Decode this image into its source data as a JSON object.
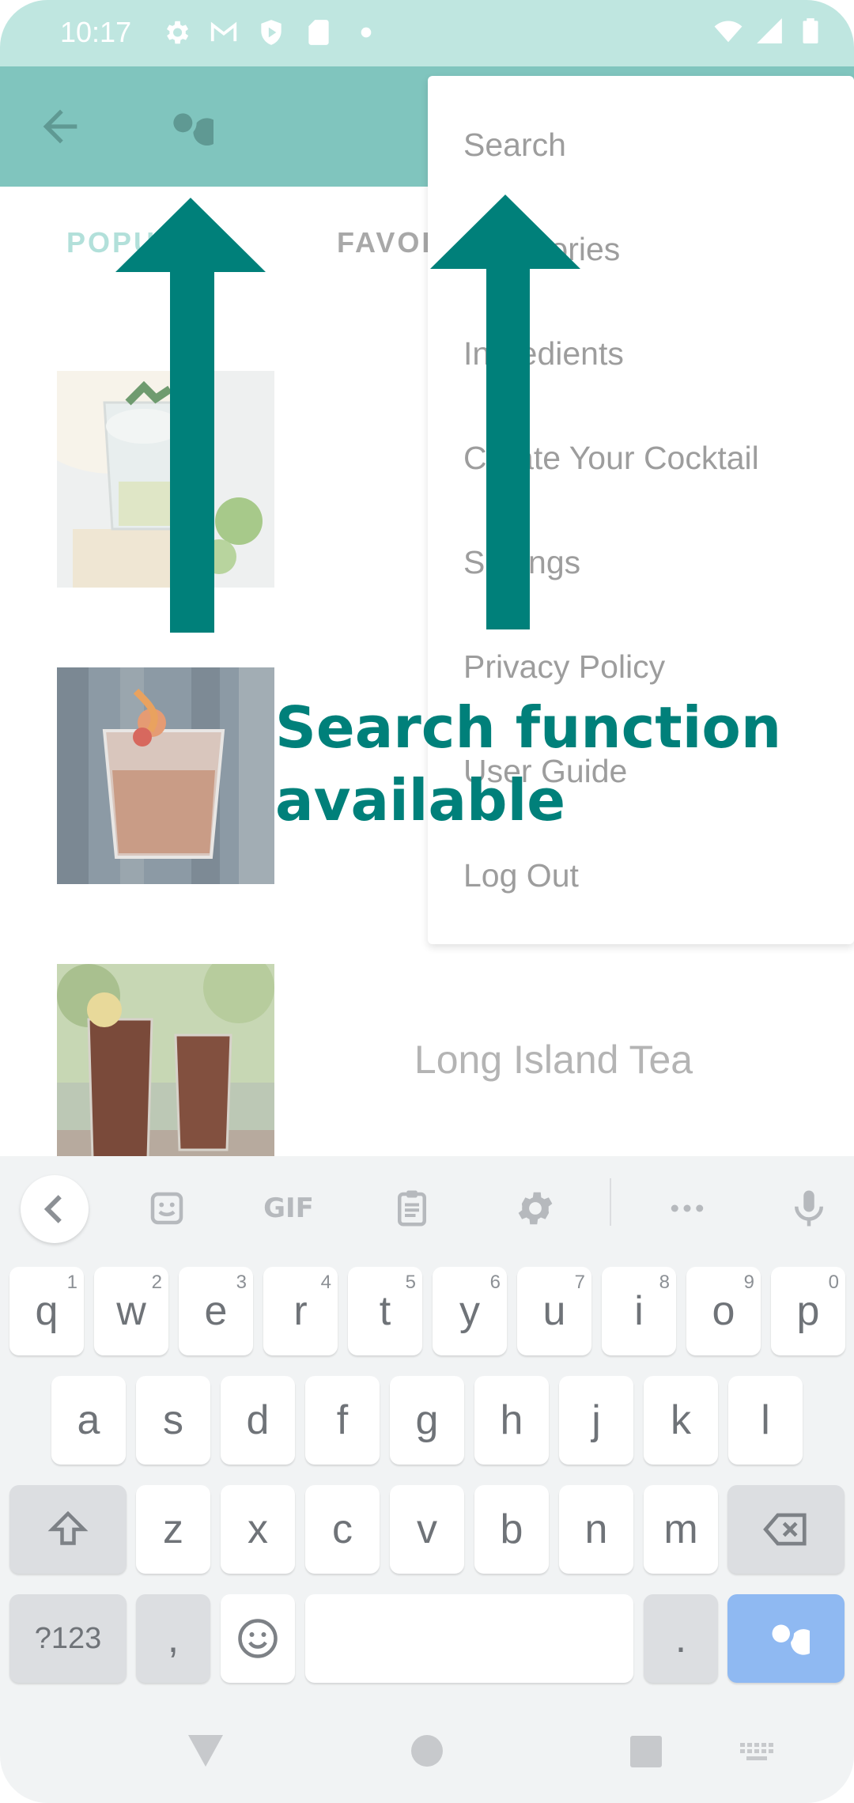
{
  "status_bar": {
    "time": "10:17",
    "left_icons": [
      "gear-icon",
      "gmail-icon",
      "shield-icon",
      "sdcard-icon",
      "dot-icon"
    ],
    "right_icons": [
      "wifi-icon",
      "signal-icon",
      "battery-icon"
    ]
  },
  "app_bar": {
    "back_icon": "arrow-back-icon",
    "search_icon": "search-icon",
    "color": "#80c5be"
  },
  "tabs": [
    {
      "label": "POPULAR",
      "selected": true
    },
    {
      "label": "FAVORITES",
      "selected": false
    }
  ],
  "list": {
    "items": [
      {
        "title": "",
        "image": "mojito-photo"
      },
      {
        "title": "",
        "image": "old-fashioned-photo"
      },
      {
        "title": "Long Island Tea",
        "image": "long-island-tea-photo"
      }
    ]
  },
  "menu": {
    "items": [
      "Search",
      "Categories",
      "Ingredients",
      "Create Your Cocktail",
      "Settings",
      "Privacy Policy",
      "User Guide",
      "Log Out"
    ]
  },
  "annotation": {
    "line1": "Search function",
    "line2": "available",
    "color": "#00807a"
  },
  "keyboard": {
    "toolbar": [
      "chevron-left-icon",
      "sticker-icon",
      "GIF",
      "clipboard-icon",
      "gear-icon",
      "more-icon",
      "mic-icon"
    ],
    "row1": [
      {
        "k": "q",
        "h": "1"
      },
      {
        "k": "w",
        "h": "2"
      },
      {
        "k": "e",
        "h": "3"
      },
      {
        "k": "r",
        "h": "4"
      },
      {
        "k": "t",
        "h": "5"
      },
      {
        "k": "y",
        "h": "6"
      },
      {
        "k": "u",
        "h": "7"
      },
      {
        "k": "i",
        "h": "8"
      },
      {
        "k": "o",
        "h": "9"
      },
      {
        "k": "p",
        "h": "0"
      }
    ],
    "row2": [
      "a",
      "s",
      "d",
      "f",
      "g",
      "h",
      "j",
      "k",
      "l"
    ],
    "row3": [
      "z",
      "x",
      "c",
      "v",
      "b",
      "n",
      "m"
    ],
    "symbols_label": "?123",
    "comma_label": ",",
    "period_label": ".",
    "space_label": "",
    "accent": "#8fb9f2"
  },
  "nav_bar": [
    "back-triangle-icon",
    "home-circle-icon",
    "recents-square-icon",
    "keyboard-icon"
  ]
}
